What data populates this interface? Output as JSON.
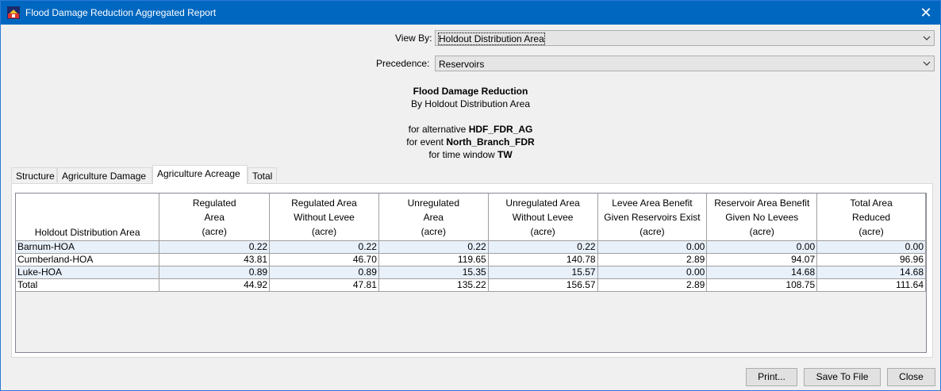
{
  "window": {
    "title": "Flood Damage Reduction Aggregated Report"
  },
  "view_by": {
    "label": "View By:",
    "value": "Holdout Distribution Area"
  },
  "precedence": {
    "label": "Precedence:",
    "value": "Reservoirs"
  },
  "report": {
    "title": "Flood Damage Reduction",
    "subtitle": "By Holdout Distribution Area",
    "alt_prefix": "for alternative ",
    "alt_value": "HDF_FDR_AG",
    "event_prefix": "for event ",
    "event_value": "North_Branch_FDR",
    "tw_prefix": "for time window ",
    "tw_value": "TW"
  },
  "tabs": [
    "Structure",
    "Agriculture Damage",
    "Agriculture Acreage",
    "Total"
  ],
  "active_tab": "Agriculture Acreage",
  "table": {
    "headers": [
      [
        "Holdout Distribution Area"
      ],
      [
        "Regulated",
        "Area",
        "(acre)"
      ],
      [
        "Regulated Area",
        "Without Levee",
        "(acre)"
      ],
      [
        "Unregulated",
        "Area",
        "(acre)"
      ],
      [
        "Unregulated Area",
        "Without Levee",
        "(acre)"
      ],
      [
        "Levee Area Benefit",
        "Given Reservoirs Exist",
        "(acre)"
      ],
      [
        "Reservoir Area Benefit",
        "Given No Levees",
        "(acre)"
      ],
      [
        "Total Area",
        "Reduced",
        "(acre)"
      ]
    ],
    "rows": [
      [
        "Barnum-HOA",
        "0.22",
        "0.22",
        "0.22",
        "0.22",
        "0.00",
        "0.00",
        "0.00"
      ],
      [
        "Cumberland-HOA",
        "43.81",
        "46.70",
        "119.65",
        "140.78",
        "2.89",
        "94.07",
        "96.96"
      ],
      [
        "Luke-HOA",
        "0.89",
        "0.89",
        "15.35",
        "15.57",
        "0.00",
        "14.68",
        "14.68"
      ],
      [
        "Total",
        "44.92",
        "47.81",
        "135.22",
        "156.57",
        "2.89",
        "108.75",
        "111.64"
      ]
    ]
  },
  "buttons": {
    "print": "Print...",
    "save": "Save To File",
    "close": "Close"
  },
  "colors": {
    "titlebar": "#0067c0",
    "row_alt": "#e8f0fa"
  }
}
